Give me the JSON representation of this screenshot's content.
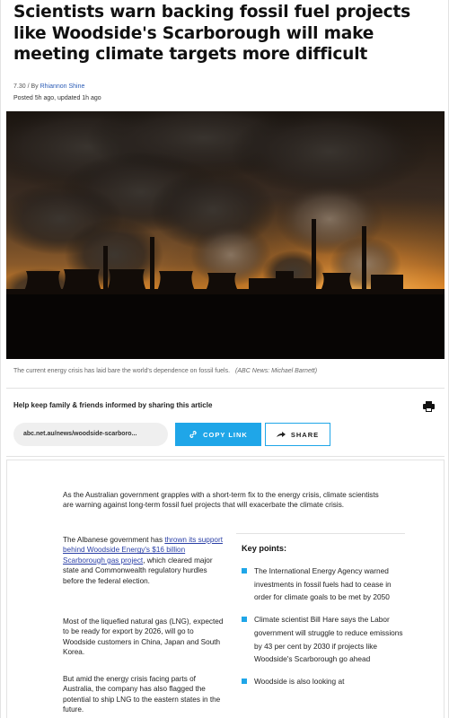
{
  "article": {
    "headline": "Scientists warn backing fossil fuel projects like Woodside's Scarborough will make meeting climate targets more difficult",
    "time": "7.30",
    "by_prefix": " / By ",
    "author": "Rhiannon Shine",
    "posted": "Posted 5h ago, updated 1h ago"
  },
  "image": {
    "caption": "The current energy crisis has laid bare the world's dependence on fossil fuels.",
    "credit": "(ABC News: Michael Barnett)"
  },
  "share": {
    "title": "Help keep family & friends informed by sharing this article",
    "url": "abc.net.au/news/woodside-scarboro...",
    "copy_label": "COPY LINK",
    "share_label": "SHARE",
    "print_icon": "printer-icon"
  },
  "body": {
    "intro": "As the Australian government grapples with a short-term fix to the energy crisis, climate scientists are warning against long-term fossil fuel projects that will exacerbate the climate crisis.",
    "p2_before": "The Albanese government has ",
    "p2_link": "thrown its support behind Woodside Energy's $16 billion Scarborough gas project",
    "p2_after": ", which cleared major state and Commonwealth regulatory hurdles before the federal election.",
    "p3": "Most of the liquefied natural gas (LNG), expected to be ready for export by 2026, will go to Woodside customers in China, Japan and South Korea.",
    "p4": "But amid the energy crisis facing parts of Australia, the company has also flagged the potential to ship LNG to the eastern states in the future."
  },
  "key_points": {
    "title": "Key points:",
    "items": [
      "The International Energy Agency warned investments in fossil fuels had to cease in order for climate goals to be met by 2050",
      "Climate scientist Bill Hare says the Labor government will struggle to reduce emissions by 43 per cent by 2030 if projects like Woodside's Scarborough go ahead",
      "Woodside is also looking at"
    ]
  },
  "colors": {
    "accent": "#1fa6e8",
    "link": "#2a3fa6",
    "byline_link": "#2a5bb6"
  }
}
